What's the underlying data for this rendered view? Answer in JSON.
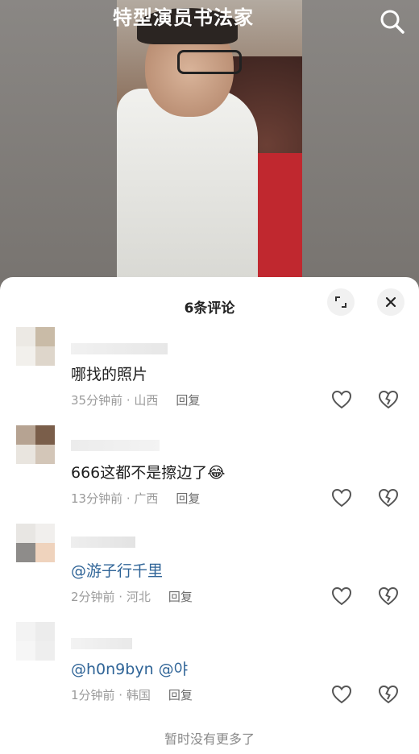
{
  "video": {
    "title_text": "特型演员书法家",
    "search_icon": "search-icon"
  },
  "sheet": {
    "title": "6条评论",
    "expand_icon": "expand-icon",
    "close_icon": "close-icon",
    "footer": "暂时没有更多了"
  },
  "comments": [
    {
      "text": "哪找的照片",
      "time": "35分钟前 · 山西",
      "reply": "回复",
      "is_mention": false
    },
    {
      "text": "666这都不是擦边了😂",
      "time": "13分钟前 · 广西",
      "reply": "回复",
      "is_mention": false
    },
    {
      "text": "@游子行千里",
      "time": "2分钟前 · 河北",
      "reply": "回复",
      "is_mention": true
    },
    {
      "text": "@h0n9byn @야",
      "time": "1分钟前 · 韩国",
      "reply": "回复",
      "is_mention": true
    }
  ],
  "colors": {
    "mention": "#2f6497",
    "meta": "#9b9b9b",
    "sheet_bg": "#ffffff"
  }
}
